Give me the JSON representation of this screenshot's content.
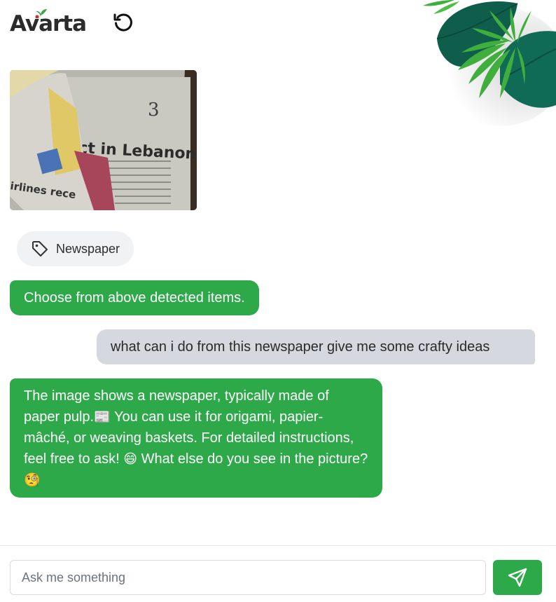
{
  "header": {
    "brand": "Avarta",
    "icons": {
      "reset": "reset-icon",
      "leaf": "sprout-icon"
    }
  },
  "decoration": {
    "leaves": "tropical-leaves"
  },
  "upload": {
    "image": "newspaper-photo",
    "headline_visible": "ct in Lebanon",
    "page_number": "3",
    "side_text": "irlines rece"
  },
  "detected_items": [
    {
      "label": "Newspaper",
      "icon": "tag-icon"
    }
  ],
  "messages": [
    {
      "role": "bot",
      "text": "Choose from above detected items."
    },
    {
      "role": "user",
      "text": "what can i do from this newspaper give me some crafty ideas"
    },
    {
      "role": "bot",
      "parts": [
        "The image shows a newspaper, typically made of paper pulp.",
        "📰",
        " You can use it for origami, papier-mâché, or weaving baskets. For detailed instructions, feel free to ask! ",
        "😄",
        " What else do you see in the picture? ",
        "🧐"
      ]
    }
  ],
  "composer": {
    "placeholder": "Ask me something",
    "send_icon": "send-icon"
  },
  "colors": {
    "accent": "#2ea94a",
    "user_bubble": "#d5d8de",
    "chip_bg": "#f1f2f4"
  }
}
